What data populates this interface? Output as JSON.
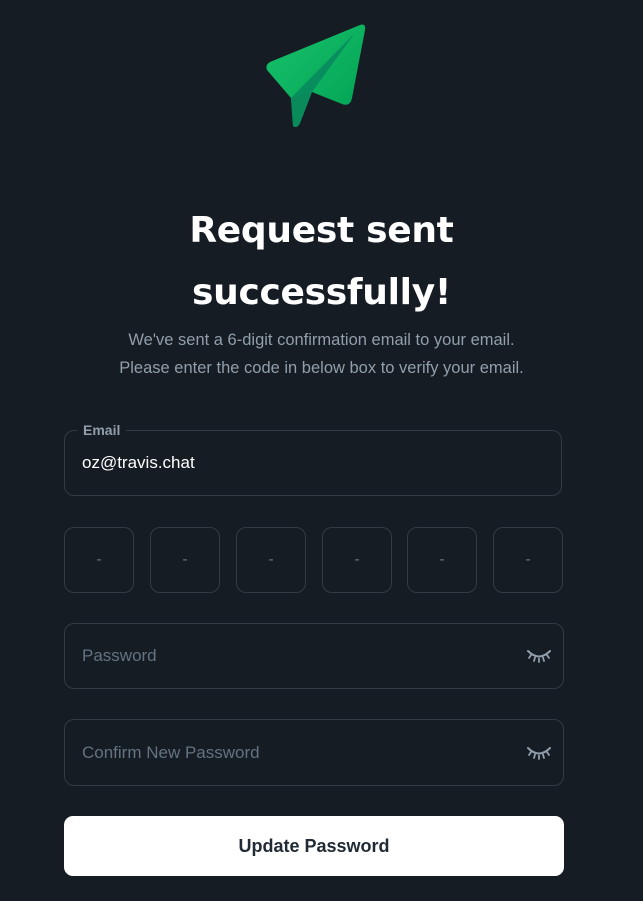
{
  "header": {
    "logo_icon": "paper-plane-icon",
    "title_line1": "Request sent",
    "title_line2": "successfully!",
    "subtitle_line1": "We've sent a 6-digit confirmation email to your email.",
    "subtitle_line2": "Please enter the code in below box to verify your email."
  },
  "form": {
    "email": {
      "label": "Email",
      "value": "oz@travis.chat"
    },
    "code_digits": [
      "-",
      "-",
      "-",
      "-",
      "-",
      "-"
    ],
    "password": {
      "placeholder": "Password",
      "icon": "eye-closed-icon"
    },
    "confirm_password": {
      "placeholder": "Confirm New Password",
      "icon": "eye-closed-icon"
    },
    "submit_label": "Update Password"
  },
  "colors": {
    "background": "#161c24",
    "accent_green": "#00ab55",
    "border": "#323b45",
    "muted_text": "#919eab",
    "placeholder_text": "#637381",
    "button_bg": "#ffffff",
    "button_text": "#212b36"
  }
}
